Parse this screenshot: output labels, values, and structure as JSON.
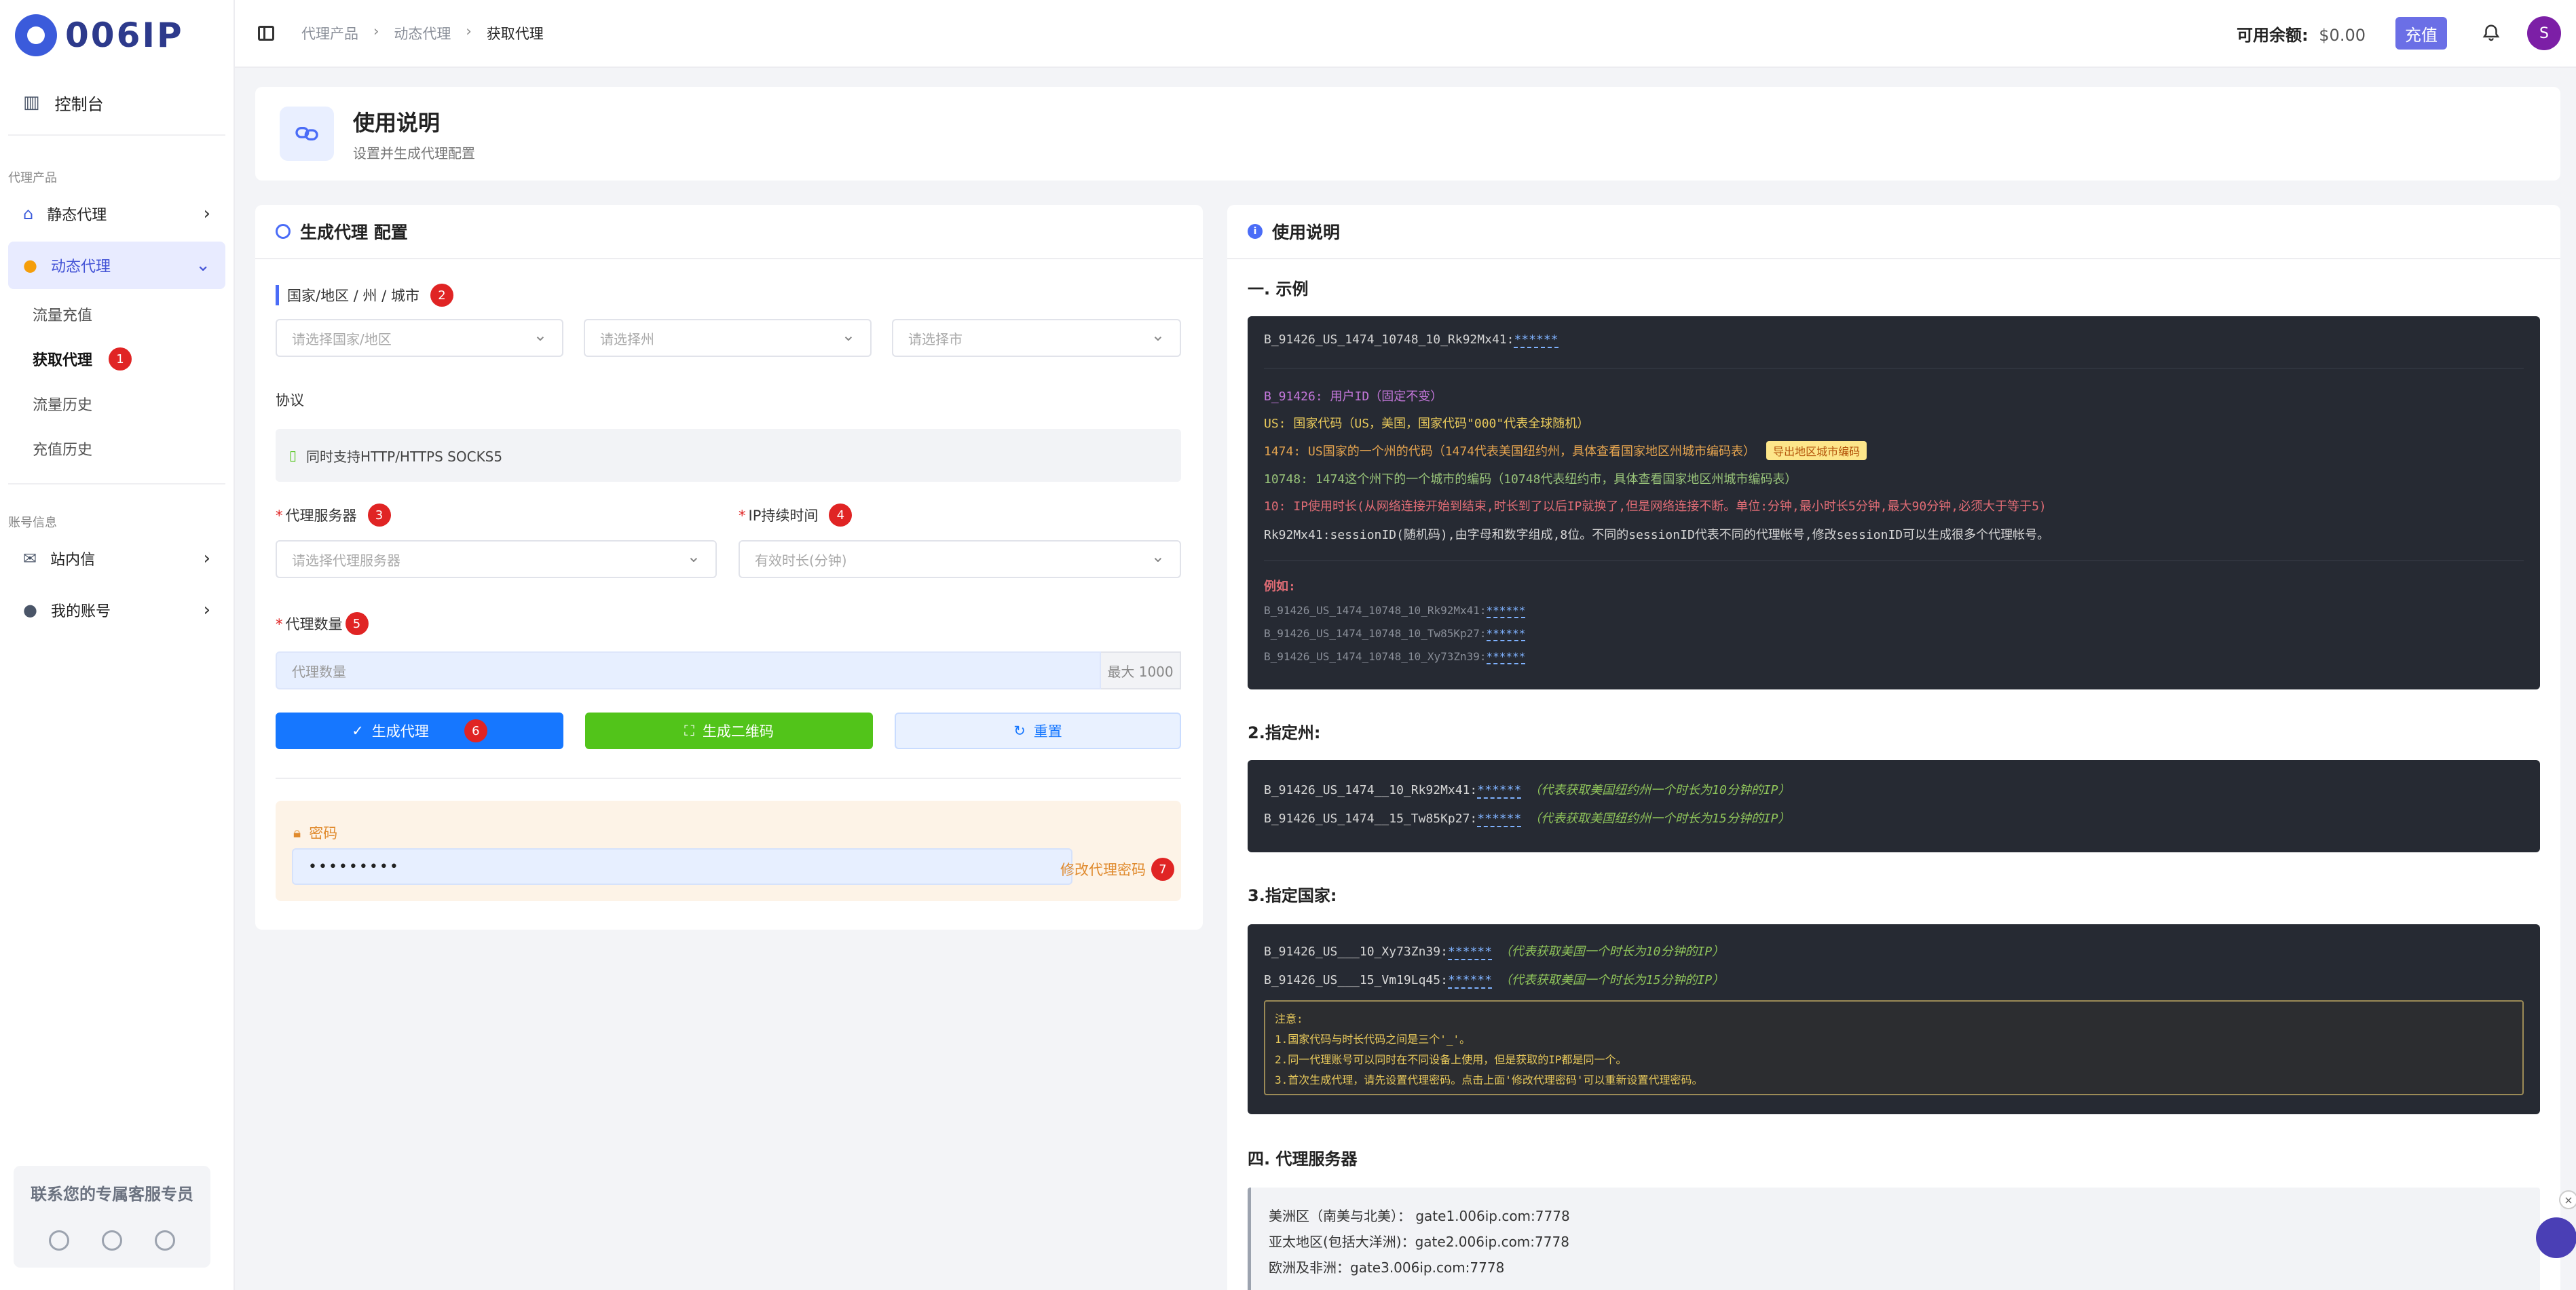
{
  "brand": {
    "logo_text": "006IP"
  },
  "sidebar": {
    "dashboard": "控制台",
    "section_products": "代理产品",
    "static_proxy": "静态代理",
    "dynamic_proxy": "动态代理",
    "sub_items": [
      "流量充值",
      "获取代理",
      "流量历史",
      "充值历史"
    ],
    "section_account": "账号信息",
    "messages": "站内信",
    "my_account": "我的账号",
    "support_title": "联系您的专属客服专员"
  },
  "badges": [
    "1",
    "2",
    "3",
    "4",
    "5",
    "6",
    "7"
  ],
  "topbar": {
    "breadcrumb": [
      "代理产品",
      "动态代理",
      "获取代理"
    ],
    "balance_label": "可用余额:",
    "balance_value": "$0.00",
    "recharge": "充值",
    "avatar": "S"
  },
  "header": {
    "title": "使用说明",
    "subtitle": "设置并生成代理配置"
  },
  "config": {
    "title": "生成代理 配置",
    "region_label": "国家/地区 / 州 / 城市",
    "country_placeholder": "请选择国家/地区",
    "state_placeholder": "请选择州",
    "city_placeholder": "请选择市",
    "protocol_label": "协议",
    "protocol_value": "同时支持HTTP/HTTPS SOCKS5",
    "server_label": "代理服务器",
    "server_placeholder": "请选择代理服务器",
    "duration_label": "IP持续时间",
    "duration_placeholder": "有效时长(分钟)",
    "qty_label": "代理数量",
    "qty_placeholder": "代理数量",
    "qty_max": "最大 1000",
    "btn_generate": "生成代理",
    "btn_qr": "生成二维码",
    "btn_reset": "重置",
    "pwd_label": "密码",
    "pwd_value": "•••••••••",
    "pwd_link": "修改代理密码"
  },
  "instructions": {
    "title": "使用说明",
    "s1_title": "一. 示例",
    "s1_main": "B_91426_US_1474_10748_10_Rk92Mx41:",
    "stars": "******",
    "s1_lines": [
      {
        "key": "B_91426:",
        "text": "用户ID（固定不变）"
      },
      {
        "key": "US:",
        "text": "国家代码（US，美国，国家代码\"000\"代表全球随机）"
      },
      {
        "key": "1474:",
        "text": "US国家的一个州的代码（1474代表美国纽约州，具体查看国家地区州城市编码表）"
      },
      {
        "key": "10748:",
        "text": "1474这个州下的一个城市的编码（10748代表纽约市，具体查看国家地区州城市编码表）"
      },
      {
        "key": "10:",
        "text": "IP使用时长(从网络连接开始到结束,时长到了以后IP就换了,但是网络连接不断。单位:分钟,最小时长5分钟,最大90分钟,必须大于等于5)"
      }
    ],
    "s1_session": "Rk92Mx41:sessionID(随机码),由字母和数字组成,8位。不同的sessionID代表不同的代理帐号,修改sessionID可以生成很多个代理帐号。",
    "export_tag": "导出地区城市编码",
    "example_label": "例如:",
    "examples": [
      "B_91426_US_1474_10748_10_Rk92Mx41:",
      "B_91426_US_1474_10748_10_Tw85Kp27:",
      "B_91426_US_1474_10748_10_Xy73Zn39:"
    ],
    "s2_title": "2.指定州:",
    "s2_lines": [
      {
        "code": "B_91426_US_1474__10_Rk92Mx41:",
        "comment": "（代表获取美国纽约州一个时长为10分钟的IP）"
      },
      {
        "code": "B_91426_US_1474__15_Tw85Kp27:",
        "comment": "（代表获取美国纽约州一个时长为15分钟的IP）"
      }
    ],
    "s3_title": "3.指定国家:",
    "s3_lines": [
      {
        "code": "B_91426_US___10_Xy73Zn39:",
        "comment": "（代表获取美国一个时长为10分钟的IP）"
      },
      {
        "code": "B_91426_US___15_Vm19Lq45:",
        "comment": "（代表获取美国一个时长为15分钟的IP）"
      }
    ],
    "note_lines": [
      "注意:",
      "1.国家代码与时长代码之间是三个'_'。",
      "2.同一代理账号可以同时在不同设备上使用，但是获取的IP都是同一个。",
      "3.首次生成代理，请先设置代理密码。点击上面'修改代理密码'可以重新设置代理密码。"
    ],
    "s4_title": "四. 代理服务器",
    "servers": [
      "美洲区（南美与北美）： gate1.006ip.com:7778",
      "亚太地区(包括大洋洲)：gate2.006ip.com:7778",
      "欧洲及非洲：gate3.006ip.com:7778"
    ]
  }
}
